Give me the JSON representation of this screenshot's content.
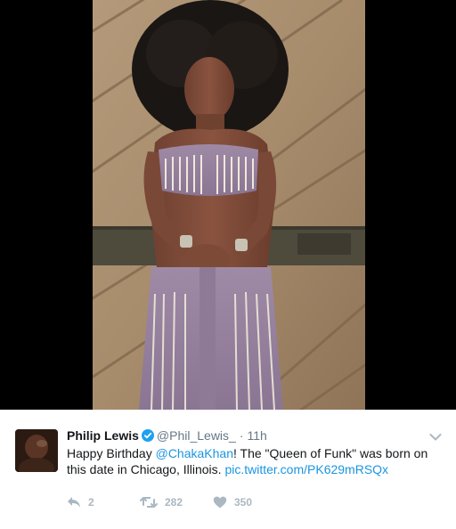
{
  "tweet": {
    "name": "Philip Lewis",
    "handle": "@Phil_Lewis_",
    "separator": "·",
    "time": "11h",
    "text_before_mention": "Happy Birthday ",
    "mention": "@ChakaKhan",
    "text_after_mention": "! The  \"Queen of Funk\" was born on this date in Chicago, Illinois. ",
    "media_link": "pic.twitter.com/PK629mRSQx"
  },
  "actions": {
    "replies": "2",
    "retweets": "282",
    "likes": "350"
  },
  "colors": {
    "link": "#1b95e0",
    "verified": "#1da1f2",
    "action_gray": "#aab8c2",
    "media_background": "#000000"
  },
  "icons": {
    "verified": "verified-badge-icon",
    "caret": "chevron-down-icon",
    "reply": "reply-icon",
    "retweet": "retweet-icon",
    "like": "heart-icon"
  }
}
